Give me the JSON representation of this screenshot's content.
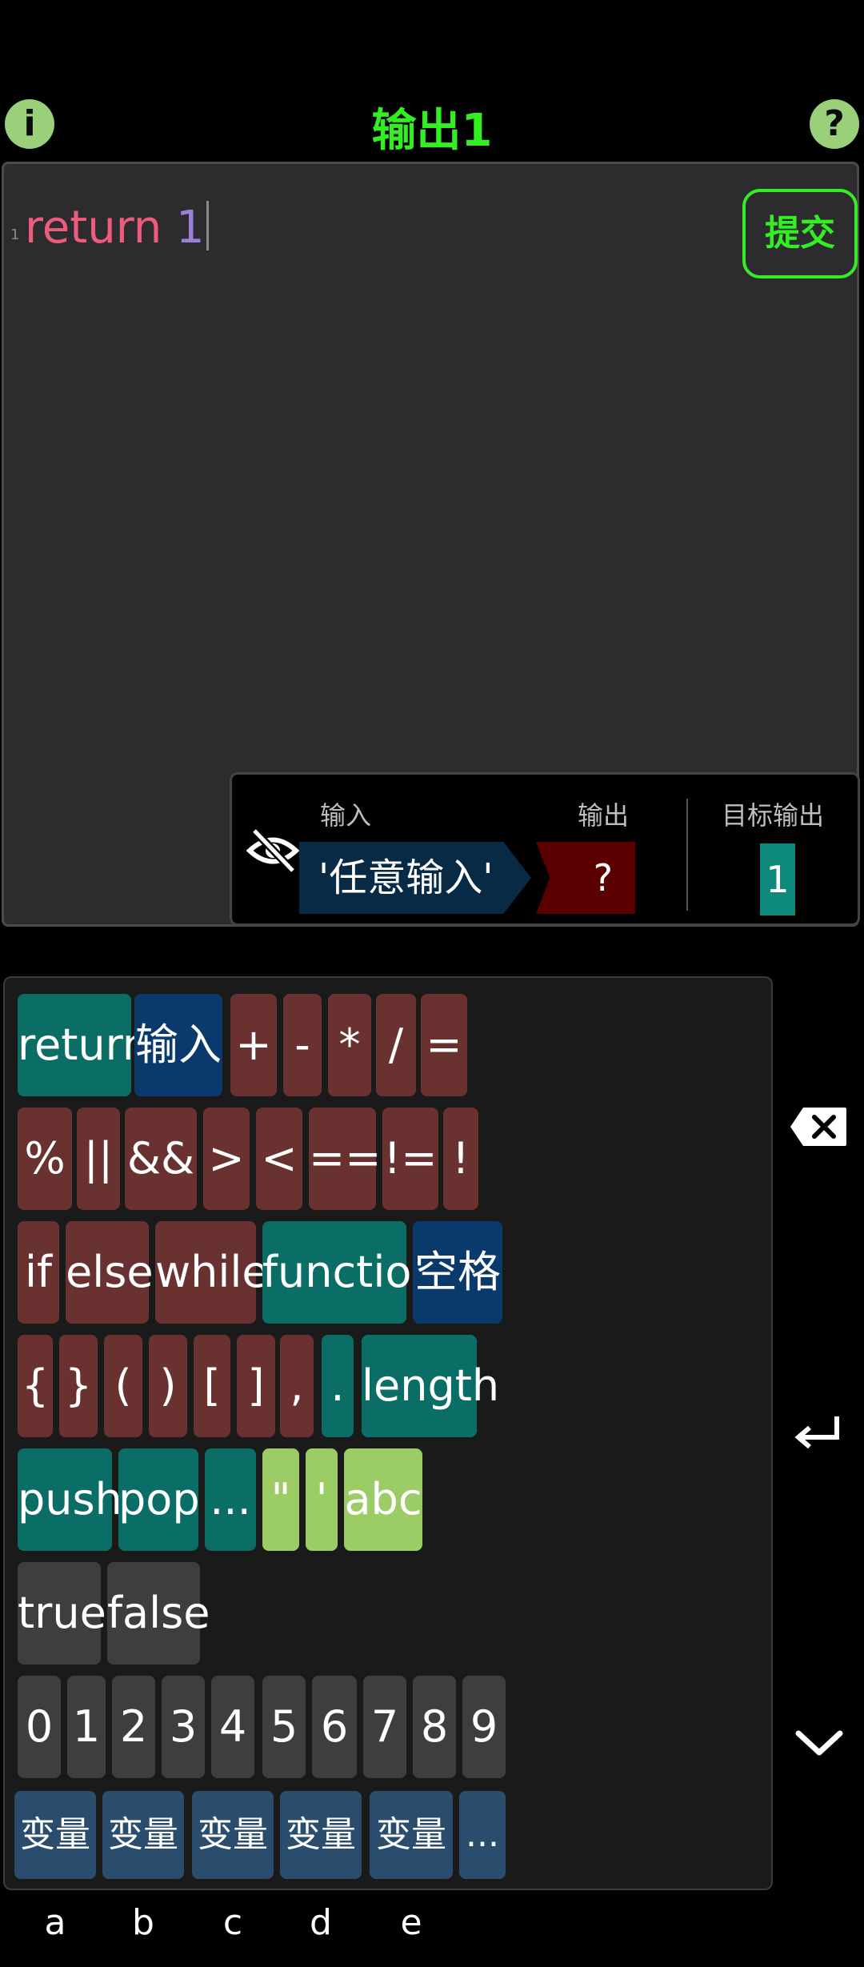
{
  "header": {
    "title": "输出1",
    "info_icon": "i",
    "help_icon": "?"
  },
  "editor": {
    "line_number": "1",
    "keyword": "return",
    "value": "1",
    "submit_label": "提交"
  },
  "io_panel": {
    "input_label": "输入",
    "output_label": "输出",
    "target_label": "目标输出",
    "input_value": "'任意输入'",
    "output_value": "?",
    "target_value": "1"
  },
  "keyboard": {
    "rows": [
      [
        "return",
        "输入",
        "+",
        "-",
        "*",
        "/",
        "="
      ],
      [
        "%",
        "||",
        "&&",
        ">",
        "<",
        "==",
        "!=",
        "!"
      ],
      [
        "if",
        "else",
        "while",
        "function",
        "空格"
      ],
      [
        "{",
        "}",
        "(",
        ")",
        "[",
        "]",
        ",",
        ".",
        "length"
      ],
      [
        "push",
        "pop",
        "...",
        "\"",
        "'",
        "abc"
      ],
      [
        "true",
        "false"
      ],
      [
        "0",
        "1",
        "2",
        "3",
        "4",
        "5",
        "6",
        "7",
        "8",
        "9"
      ],
      [
        "变量a",
        "变量b",
        "变量c",
        "变量d",
        "变量e",
        "..."
      ]
    ]
  },
  "side_controls": {
    "backspace_icon": "backspace-icon",
    "enter_icon": "enter-icon",
    "collapse_icon": "chevron-down-icon"
  },
  "colors": {
    "accent": "#33ee22",
    "keyword": "#ef5b7d",
    "number": "#9b7fd8"
  }
}
